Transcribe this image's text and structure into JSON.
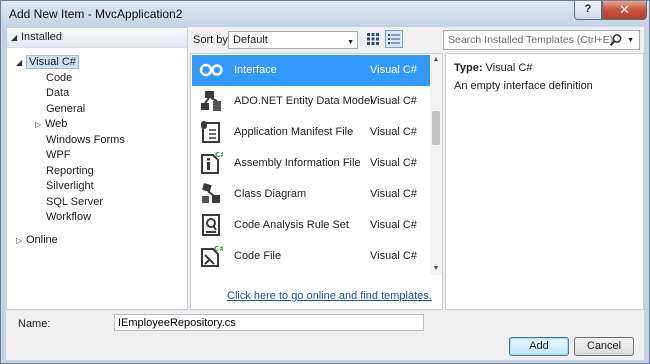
{
  "window": {
    "title": "Add New Item - MvcApplication2",
    "help_label": "?",
    "close_label": "✕"
  },
  "tree": {
    "header": "Installed",
    "root": "Visual C#",
    "children": [
      "Code",
      "Data",
      "General",
      "Web",
      "Windows Forms",
      "WPF",
      "Reporting",
      "Silverlight",
      "SQL Server",
      "Workflow"
    ],
    "online": "Online"
  },
  "sort": {
    "label": "Sort by:",
    "value": "Default"
  },
  "search": {
    "placeholder": "Search Installed Templates (Ctrl+E)"
  },
  "templates": [
    {
      "name": "Interface",
      "type": "Visual C#",
      "icon": "interface-icon"
    },
    {
      "name": "ADO.NET Entity Data Model",
      "type": "Visual C#",
      "icon": "entity-data-model-icon"
    },
    {
      "name": "Application Manifest File",
      "type": "Visual C#",
      "icon": "manifest-file-icon"
    },
    {
      "name": "Assembly Information File",
      "type": "Visual C#",
      "icon": "assembly-info-icon"
    },
    {
      "name": "Class Diagram",
      "type": "Visual C#",
      "icon": "class-diagram-icon"
    },
    {
      "name": "Code Analysis Rule Set",
      "type": "Visual C#",
      "icon": "rule-set-icon"
    },
    {
      "name": "Code File",
      "type": "Visual C#",
      "icon": "code-file-icon"
    }
  ],
  "online_link": "Click here to go online and find templates.",
  "details": {
    "type_label": "Type:",
    "type_value": "Visual C#",
    "description": "An empty interface definition"
  },
  "name_field": {
    "label": "Name:",
    "value": "IEmployeeRepository.cs"
  },
  "buttons": {
    "add": "Add",
    "cancel": "Cancel"
  },
  "colors": {
    "selection": "#3399ff",
    "link": "#1b4ec2"
  }
}
